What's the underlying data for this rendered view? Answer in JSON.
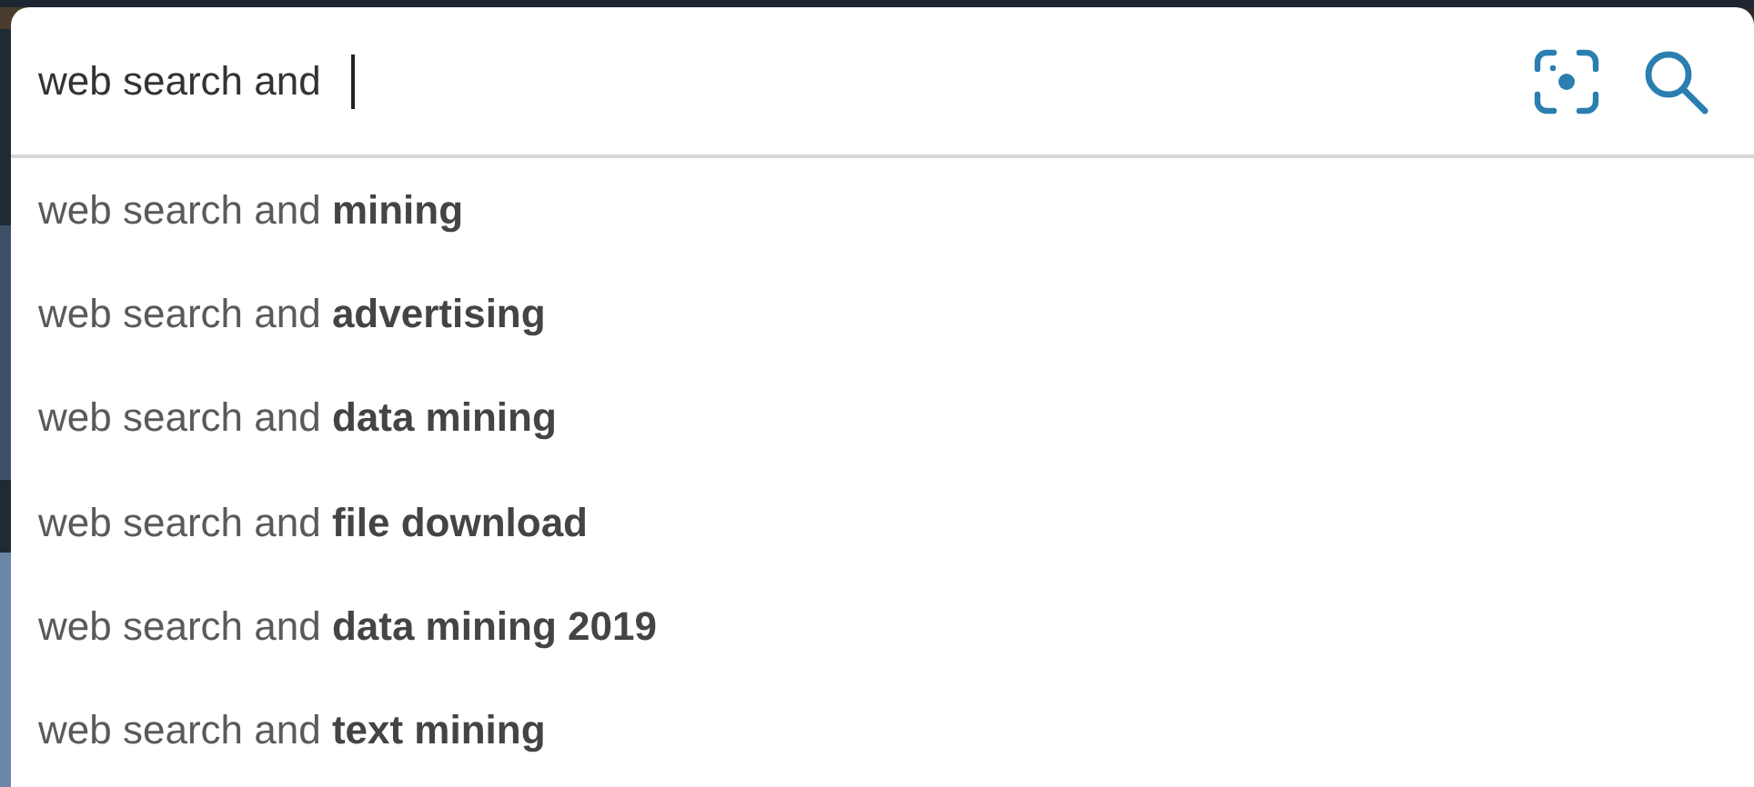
{
  "search": {
    "value": "web search and "
  },
  "suggestions": [
    {
      "text": "web search and **mining**"
    },
    {
      "text": "web search and **advertising**"
    },
    {
      "text": "web search and **data mining**"
    },
    {
      "text": "web search and **file download**"
    },
    {
      "text": "web search and **data mining 2019**"
    },
    {
      "text": "web search and **text mining**"
    }
  ]
}
